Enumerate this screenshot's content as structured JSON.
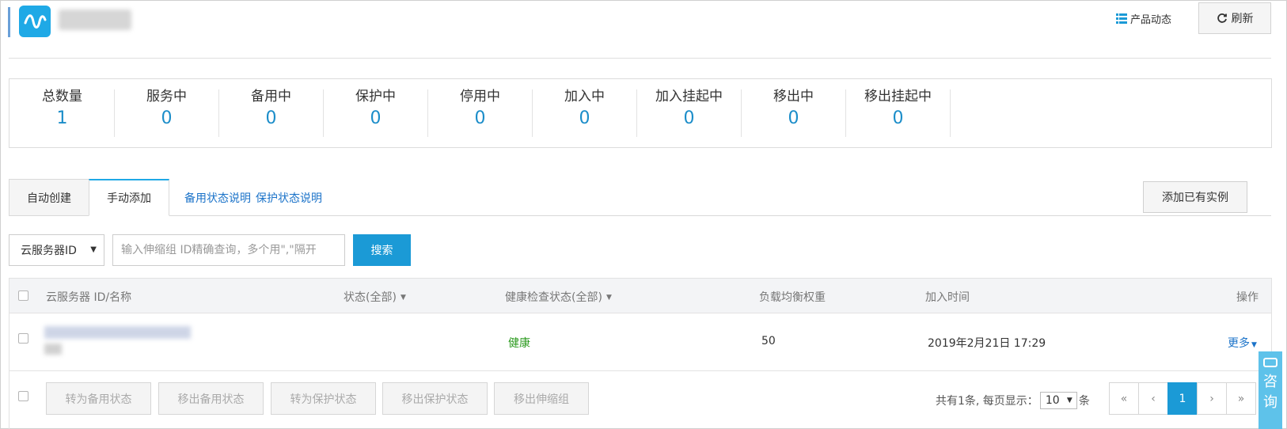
{
  "header": {
    "news_label": "产品动态",
    "refresh_label": "刷新"
  },
  "stats": [
    {
      "label": "总数量",
      "value": "1"
    },
    {
      "label": "服务中",
      "value": "0"
    },
    {
      "label": "备用中",
      "value": "0"
    },
    {
      "label": "保护中",
      "value": "0"
    },
    {
      "label": "停用中",
      "value": "0"
    },
    {
      "label": "加入中",
      "value": "0"
    },
    {
      "label": "加入挂起中",
      "value": "0"
    },
    {
      "label": "移出中",
      "value": "0"
    },
    {
      "label": "移出挂起中",
      "value": "0"
    }
  ],
  "tabs": {
    "auto_create": "自动创建",
    "manual_add": "手动添加",
    "link_standby": "备用状态说明",
    "link_protect": "保护状态说明",
    "add_existing": "添加已有实例"
  },
  "search": {
    "select_value": "云服务器ID",
    "placeholder": "输入伸缩组 ID精确查询，多个用\",\"隔开",
    "button": "搜索"
  },
  "table": {
    "headers": {
      "id_name": "云服务器 ID/名称",
      "status": "状态(全部)",
      "health": "健康检查状态(全部)",
      "weight": "负载均衡权重",
      "join_time": "加入时间",
      "actions": "操作"
    },
    "rows": [
      {
        "health": "健康",
        "weight": "50",
        "join_time": "2019年2月21日 17:29",
        "action": "更多"
      }
    ]
  },
  "footer": {
    "buttons": [
      "转为备用状态",
      "移出备用状态",
      "转为保护状态",
      "移出保护状态",
      "移出伸缩组"
    ],
    "total_text": "共有1条, 每页显示：",
    "page_size": "10",
    "unit": "条",
    "pager": [
      "«",
      "‹",
      "1",
      "›",
      "»"
    ]
  },
  "consult": {
    "label_1": "咨",
    "label_2": "询"
  },
  "colors": {
    "accent": "#1b9ad6",
    "link": "#1b73c9",
    "health_ok": "#2b9a1e",
    "stat_value": "#1b8dc9"
  }
}
